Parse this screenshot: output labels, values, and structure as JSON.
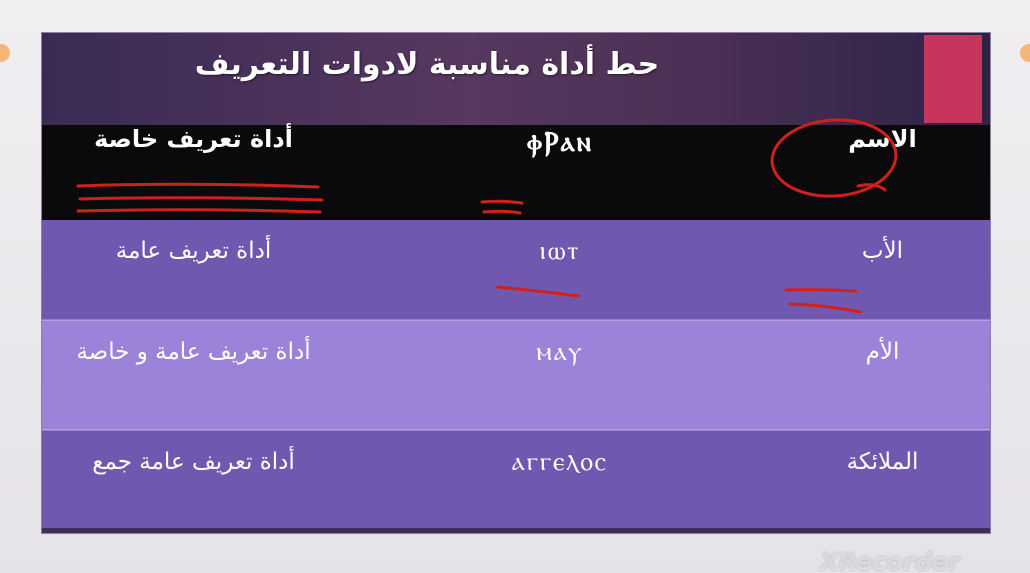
{
  "slide": {
    "title": "حط أداة مناسبة لادوات التعريف"
  },
  "table": {
    "headers": {
      "name": "الاسم",
      "word": "ⲫⲢⲁⲛ",
      "article": "أداة تعريف خاصة"
    },
    "rows": [
      {
        "name": "الأب",
        "word": "ⲓⲱⲧ",
        "article": "أداة تعريف عامة"
      },
      {
        "name": "الأم",
        "word": "ⲙⲁⲩ",
        "article": "أداة تعريف عامة و خاصة"
      },
      {
        "name": "الملائكة",
        "word": "ⲁⲅⲅⲉⲗⲟⲥ",
        "article": "أداة تعريف عامة جمع"
      }
    ]
  },
  "watermark": "XRecorder",
  "colors": {
    "accent": "#c7355c",
    "header_row": "#0a0a0c",
    "row_dark": "#7057b0",
    "row_light": "#9c82d9",
    "annotation_ink": "#d0201c"
  }
}
